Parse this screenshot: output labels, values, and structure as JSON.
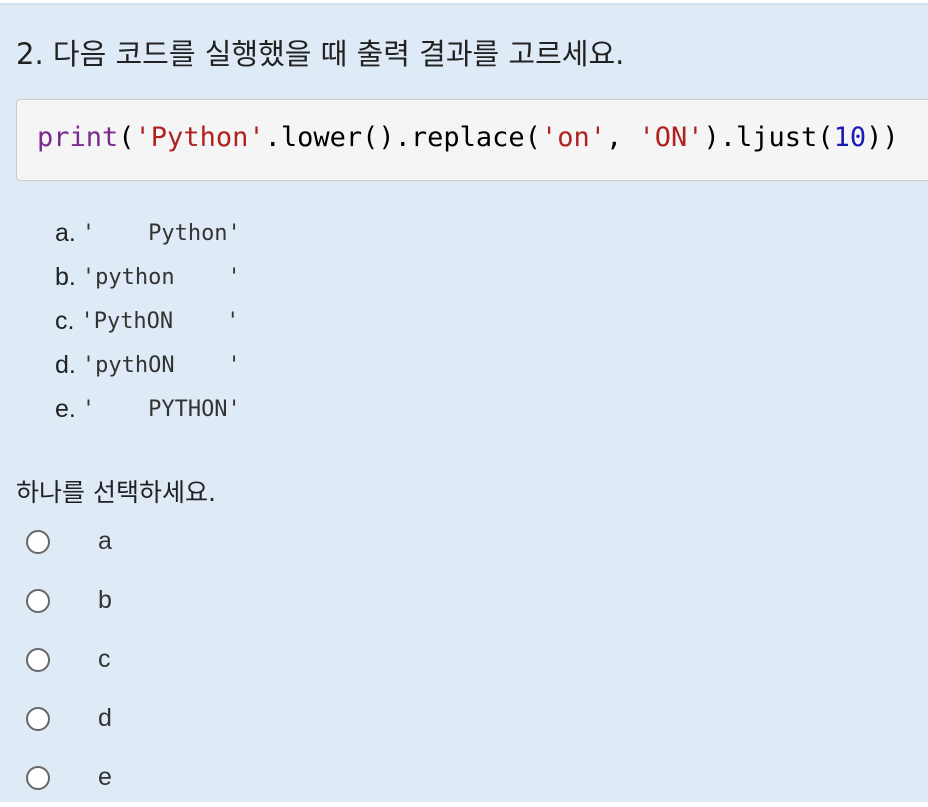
{
  "question": {
    "title": "2. 다음 코드를 실행했을 때 출력 결과를 고르세요."
  },
  "code": {
    "fn": "print",
    "p1": "(",
    "s1": "'Python'",
    "m1": ".lower().replace(",
    "s2": "'on'",
    "comma": ", ",
    "s3": "'ON'",
    "m2": ").ljust(",
    "num": "10",
    "end": "))"
  },
  "choices": [
    {
      "letter": "a.",
      "text": "'    Python'"
    },
    {
      "letter": "b.",
      "text": "'python    '"
    },
    {
      "letter": "c.",
      "text": "'PythON    '"
    },
    {
      "letter": "d.",
      "text": "'pythON    '"
    },
    {
      "letter": "e.",
      "text": "'    PYTHON'"
    }
  ],
  "prompt": "하나를 선택하세요.",
  "answers": [
    {
      "label": "a"
    },
    {
      "label": "b"
    },
    {
      "label": "c"
    },
    {
      "label": "d"
    },
    {
      "label": "e"
    }
  ]
}
